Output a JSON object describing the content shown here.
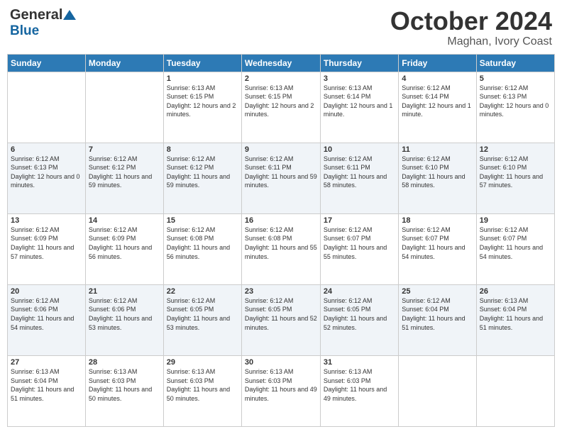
{
  "header": {
    "logo": {
      "general": "General",
      "blue": "Blue"
    },
    "month": "October 2024",
    "location": "Maghan, Ivory Coast"
  },
  "days_of_week": [
    "Sunday",
    "Monday",
    "Tuesday",
    "Wednesday",
    "Thursday",
    "Friday",
    "Saturday"
  ],
  "weeks": [
    [
      {
        "day": "",
        "sunrise": "",
        "sunset": "",
        "daylight": ""
      },
      {
        "day": "",
        "sunrise": "",
        "sunset": "",
        "daylight": ""
      },
      {
        "day": "1",
        "sunrise": "Sunrise: 6:13 AM",
        "sunset": "Sunset: 6:15 PM",
        "daylight": "Daylight: 12 hours and 2 minutes."
      },
      {
        "day": "2",
        "sunrise": "Sunrise: 6:13 AM",
        "sunset": "Sunset: 6:15 PM",
        "daylight": "Daylight: 12 hours and 2 minutes."
      },
      {
        "day": "3",
        "sunrise": "Sunrise: 6:13 AM",
        "sunset": "Sunset: 6:14 PM",
        "daylight": "Daylight: 12 hours and 1 minute."
      },
      {
        "day": "4",
        "sunrise": "Sunrise: 6:12 AM",
        "sunset": "Sunset: 6:14 PM",
        "daylight": "Daylight: 12 hours and 1 minute."
      },
      {
        "day": "5",
        "sunrise": "Sunrise: 6:12 AM",
        "sunset": "Sunset: 6:13 PM",
        "daylight": "Daylight: 12 hours and 0 minutes."
      }
    ],
    [
      {
        "day": "6",
        "sunrise": "Sunrise: 6:12 AM",
        "sunset": "Sunset: 6:13 PM",
        "daylight": "Daylight: 12 hours and 0 minutes."
      },
      {
        "day": "7",
        "sunrise": "Sunrise: 6:12 AM",
        "sunset": "Sunset: 6:12 PM",
        "daylight": "Daylight: 11 hours and 59 minutes."
      },
      {
        "day": "8",
        "sunrise": "Sunrise: 6:12 AM",
        "sunset": "Sunset: 6:12 PM",
        "daylight": "Daylight: 11 hours and 59 minutes."
      },
      {
        "day": "9",
        "sunrise": "Sunrise: 6:12 AM",
        "sunset": "Sunset: 6:11 PM",
        "daylight": "Daylight: 11 hours and 59 minutes."
      },
      {
        "day": "10",
        "sunrise": "Sunrise: 6:12 AM",
        "sunset": "Sunset: 6:11 PM",
        "daylight": "Daylight: 11 hours and 58 minutes."
      },
      {
        "day": "11",
        "sunrise": "Sunrise: 6:12 AM",
        "sunset": "Sunset: 6:10 PM",
        "daylight": "Daylight: 11 hours and 58 minutes."
      },
      {
        "day": "12",
        "sunrise": "Sunrise: 6:12 AM",
        "sunset": "Sunset: 6:10 PM",
        "daylight": "Daylight: 11 hours and 57 minutes."
      }
    ],
    [
      {
        "day": "13",
        "sunrise": "Sunrise: 6:12 AM",
        "sunset": "Sunset: 6:09 PM",
        "daylight": "Daylight: 11 hours and 57 minutes."
      },
      {
        "day": "14",
        "sunrise": "Sunrise: 6:12 AM",
        "sunset": "Sunset: 6:09 PM",
        "daylight": "Daylight: 11 hours and 56 minutes."
      },
      {
        "day": "15",
        "sunrise": "Sunrise: 6:12 AM",
        "sunset": "Sunset: 6:08 PM",
        "daylight": "Daylight: 11 hours and 56 minutes."
      },
      {
        "day": "16",
        "sunrise": "Sunrise: 6:12 AM",
        "sunset": "Sunset: 6:08 PM",
        "daylight": "Daylight: 11 hours and 55 minutes."
      },
      {
        "day": "17",
        "sunrise": "Sunrise: 6:12 AM",
        "sunset": "Sunset: 6:07 PM",
        "daylight": "Daylight: 11 hours and 55 minutes."
      },
      {
        "day": "18",
        "sunrise": "Sunrise: 6:12 AM",
        "sunset": "Sunset: 6:07 PM",
        "daylight": "Daylight: 11 hours and 54 minutes."
      },
      {
        "day": "19",
        "sunrise": "Sunrise: 6:12 AM",
        "sunset": "Sunset: 6:07 PM",
        "daylight": "Daylight: 11 hours and 54 minutes."
      }
    ],
    [
      {
        "day": "20",
        "sunrise": "Sunrise: 6:12 AM",
        "sunset": "Sunset: 6:06 PM",
        "daylight": "Daylight: 11 hours and 54 minutes."
      },
      {
        "day": "21",
        "sunrise": "Sunrise: 6:12 AM",
        "sunset": "Sunset: 6:06 PM",
        "daylight": "Daylight: 11 hours and 53 minutes."
      },
      {
        "day": "22",
        "sunrise": "Sunrise: 6:12 AM",
        "sunset": "Sunset: 6:05 PM",
        "daylight": "Daylight: 11 hours and 53 minutes."
      },
      {
        "day": "23",
        "sunrise": "Sunrise: 6:12 AM",
        "sunset": "Sunset: 6:05 PM",
        "daylight": "Daylight: 11 hours and 52 minutes."
      },
      {
        "day": "24",
        "sunrise": "Sunrise: 6:12 AM",
        "sunset": "Sunset: 6:05 PM",
        "daylight": "Daylight: 11 hours and 52 minutes."
      },
      {
        "day": "25",
        "sunrise": "Sunrise: 6:12 AM",
        "sunset": "Sunset: 6:04 PM",
        "daylight": "Daylight: 11 hours and 51 minutes."
      },
      {
        "day": "26",
        "sunrise": "Sunrise: 6:13 AM",
        "sunset": "Sunset: 6:04 PM",
        "daylight": "Daylight: 11 hours and 51 minutes."
      }
    ],
    [
      {
        "day": "27",
        "sunrise": "Sunrise: 6:13 AM",
        "sunset": "Sunset: 6:04 PM",
        "daylight": "Daylight: 11 hours and 51 minutes."
      },
      {
        "day": "28",
        "sunrise": "Sunrise: 6:13 AM",
        "sunset": "Sunset: 6:03 PM",
        "daylight": "Daylight: 11 hours and 50 minutes."
      },
      {
        "day": "29",
        "sunrise": "Sunrise: 6:13 AM",
        "sunset": "Sunset: 6:03 PM",
        "daylight": "Daylight: 11 hours and 50 minutes."
      },
      {
        "day": "30",
        "sunrise": "Sunrise: 6:13 AM",
        "sunset": "Sunset: 6:03 PM",
        "daylight": "Daylight: 11 hours and 49 minutes."
      },
      {
        "day": "31",
        "sunrise": "Sunrise: 6:13 AM",
        "sunset": "Sunset: 6:03 PM",
        "daylight": "Daylight: 11 hours and 49 minutes."
      },
      {
        "day": "",
        "sunrise": "",
        "sunset": "",
        "daylight": ""
      },
      {
        "day": "",
        "sunrise": "",
        "sunset": "",
        "daylight": ""
      }
    ]
  ]
}
